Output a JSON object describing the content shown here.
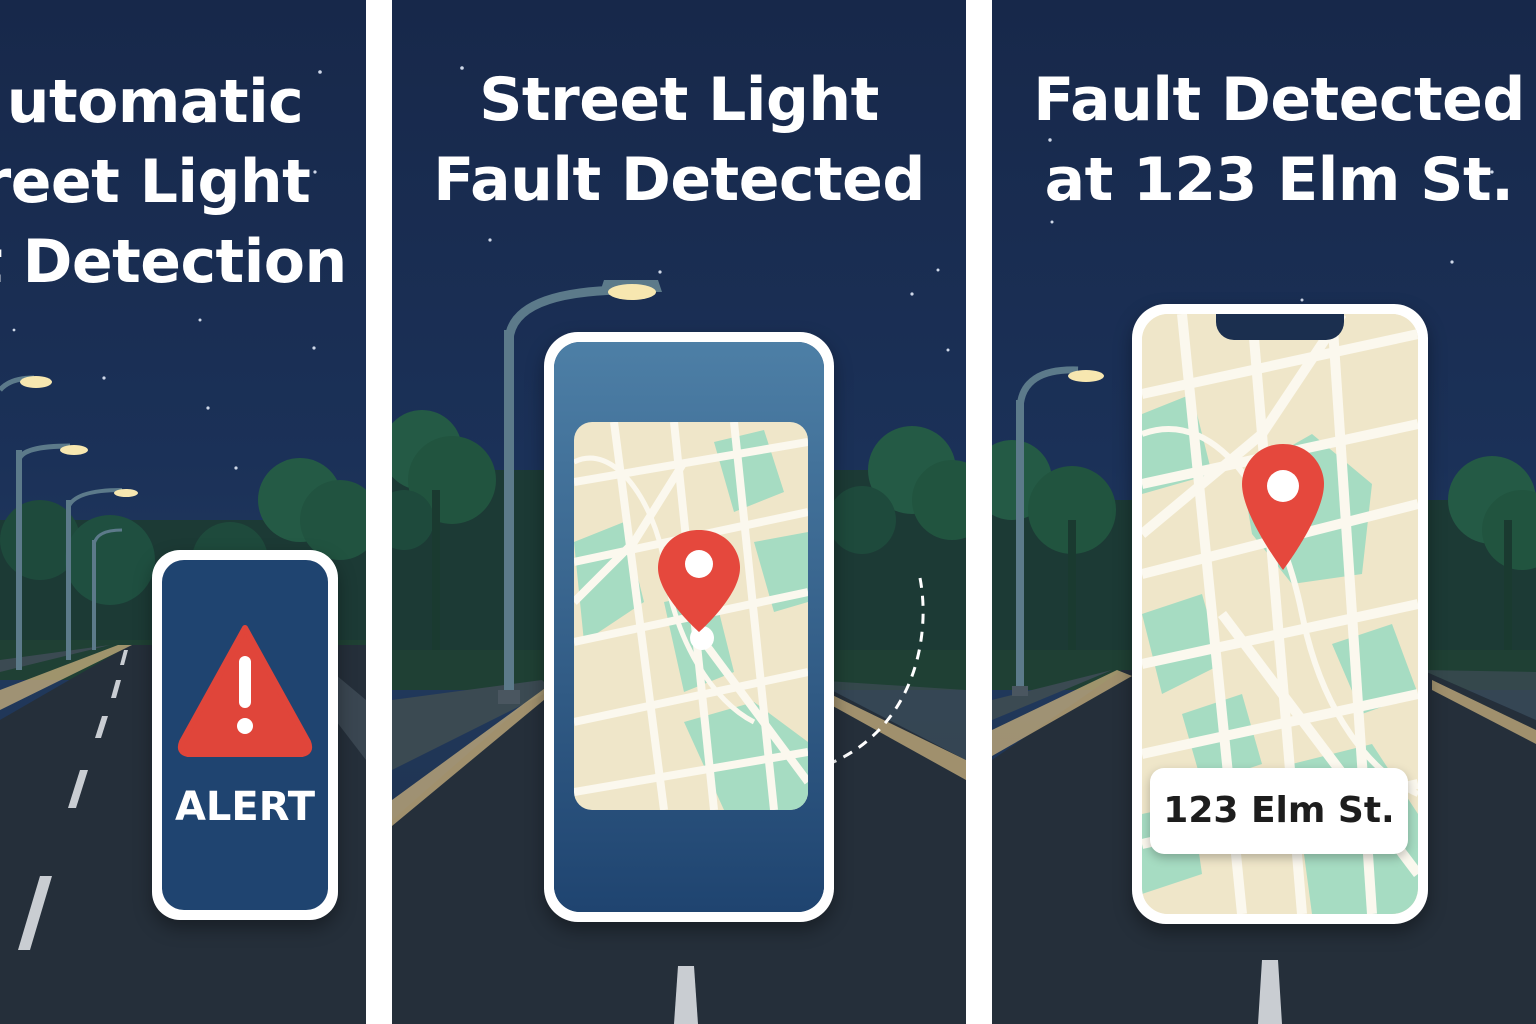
{
  "panels": [
    {
      "title_lines": [
        "utomatic",
        "reet Light",
        "t Detection"
      ],
      "alert_label": "ALERT"
    },
    {
      "title_lines": [
        "Street Light",
        "Fault Detected"
      ]
    },
    {
      "title_lines": [
        "Fault Detected",
        "at 123 Elm St."
      ],
      "address_label": "123 Elm St."
    }
  ],
  "colors": {
    "sky": "#17284a",
    "road": "#252f3a",
    "map_base": "#efe6c9",
    "map_park": "#a6dcc2",
    "pin": "#e5483d",
    "alert": "#e0453a",
    "phone_screen": "#1f4470"
  }
}
